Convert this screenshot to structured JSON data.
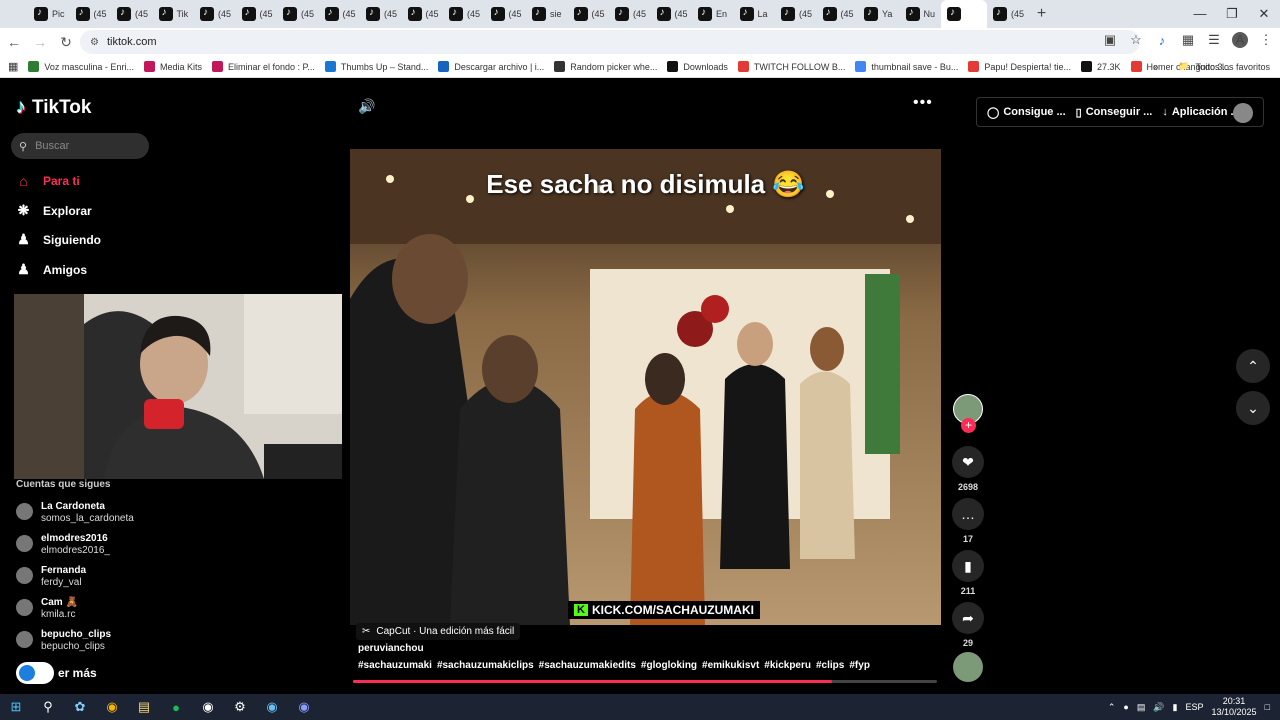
{
  "browser": {
    "tabs": [
      "Pic",
      "(45",
      "(45",
      "Tik",
      "(45",
      "(45",
      "(45",
      "(45",
      "(45",
      "(45",
      "(45",
      "(45",
      "sie",
      "(45",
      "(45",
      "(45",
      "En",
      "La",
      "(45",
      "(45",
      "Ya",
      "Nu",
      "",
      "(45"
    ],
    "url": "tiktok.com",
    "bookmarks": [
      {
        "label": "Voz masculina - Enri...",
        "color": "#2e7d32"
      },
      {
        "label": "Media Kits",
        "color": "#c2185b"
      },
      {
        "label": "Eliminar el fondo : P...",
        "color": "#c2185b"
      },
      {
        "label": "Thumbs Up – Stand...",
        "color": "#1976d2"
      },
      {
        "label": "Descargar archivo | i...",
        "color": "#1565c0"
      },
      {
        "label": "Random picker whe...",
        "color": "#333333"
      },
      {
        "label": "Downloads",
        "color": "#111111"
      },
      {
        "label": "TWITCH FOLLOW B...",
        "color": "#e53935"
      },
      {
        "label": "thumbnail save - Bu...",
        "color": "#4285f4"
      },
      {
        "label": "Papu! Despierta! tie...",
        "color": "#e53935"
      },
      {
        "label": "27.3K",
        "color": "#111111"
      },
      {
        "label": "Homer changuito.3...",
        "color": "#e53935"
      }
    ],
    "all_bookmarks": "Todos los favoritos"
  },
  "tiktok": {
    "logo": "TikTok",
    "search_placeholder": "Buscar",
    "nav": [
      {
        "label": "Para ti",
        "icon": "home-icon"
      },
      {
        "label": "Explorar",
        "icon": "compass-icon"
      },
      {
        "label": "Siguiendo",
        "icon": "following-icon"
      },
      {
        "label": "Amigos",
        "icon": "friends-icon"
      }
    ],
    "following_title": "Cuentas que sigues",
    "accounts": [
      {
        "name": "La Cardoneta",
        "handle": "somos_la_cardoneta"
      },
      {
        "name": "elmodres2016",
        "handle": "elmodres2016_"
      },
      {
        "name": "Fernanda",
        "handle": "ferdy_val"
      },
      {
        "name": "Cam 🧸",
        "handle": "kmila.rc"
      },
      {
        "name": "bepucho_clips",
        "handle": "bepucho_clips"
      }
    ],
    "see_more": "er más",
    "top_actions": [
      "Consigue ...",
      "Conseguir ...",
      "Aplicación ..."
    ],
    "video": {
      "caption": "Ese sacha no disimula 😂",
      "kick_text": "KICK.COM/SACHAUZUMAKI",
      "capcut": "CapCut · Una edición más fácil",
      "author": "peruvianchou",
      "hashtags": [
        "#sachauzumaki",
        "#sachauzumakiclips",
        "#sachauzumakiedits",
        "#glogloking",
        "#emikukisvt",
        "#kickperu",
        "#clips",
        "#fyp"
      ],
      "progress": 0.82
    },
    "stats": {
      "likes": "2698",
      "comments": "17",
      "saves": "211",
      "shares": "29"
    }
  },
  "taskbar": {
    "lang": "ESP",
    "time": "20:31",
    "date": "13/10/2025"
  }
}
